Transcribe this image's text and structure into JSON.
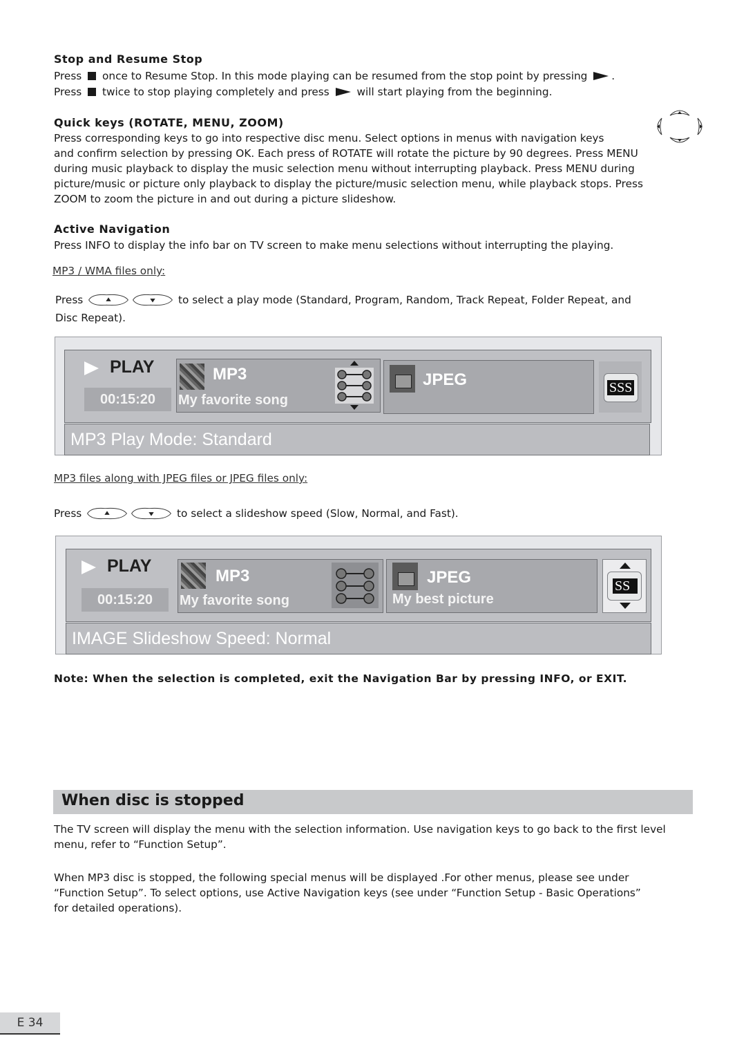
{
  "stop_section": {
    "heading": "Stop  and  Resume  Stop",
    "line1_pre": "Press",
    "line1_post": "once to Resume Stop. In this mode playing can be resumed from the stop point by pressing",
    "line1_end": ".",
    "line2_pre": "Press",
    "line2_mid": "twice to stop playing completely and press",
    "line2_post": "will start playing from the beginning.",
    "stop_icon": "stop-square-icon",
    "play_icon": "play-triangle-icon"
  },
  "quick_keys": {
    "heading": "Quick keys (ROTATE, MENU, ZOOM)",
    "line1": "Press corresponding keys to go into respective disc menu.  Select options in menus with navigation keys",
    "line2": "and confirm selection by pressing OK.  Each press of ROTATE will rotate the picture by 90 degrees.  Press MENU",
    "line3": "during music playback to display the music selection menu without interrupting playback.  Press MENU during",
    "line4": "picture/music or picture only playback to display the picture/music selection menu, while playback stops.  Press",
    "line5": "ZOOM  to zoom the picture in and out during a picture slideshow.",
    "nav_icon": "navigation-keys-icon"
  },
  "active_nav": {
    "heading": "Active  Navigation",
    "text": "Press INFO  to display the info bar on TV screen to make menu selections without interrupting the playing."
  },
  "mp3_wma": {
    "label": "MP3 / WMA files only:",
    "press": "Press",
    "text_a": "to select a play mode (Standard, Program, Random, Track Repeat, Folder Repeat, and",
    "text_b": "Disc Repeat)."
  },
  "osd1": {
    "play_label": "PLAY",
    "time": "00:15:20",
    "mp3_title": "MP3",
    "mp3_song": "My favorite song",
    "jpeg_title": "JPEG",
    "jpeg_sub": "",
    "speed_label": "SSS",
    "mode_text": "MP3 Play Mode: Standard"
  },
  "jpeg_section": {
    "label": "MP3 files along with JPEG files or JPEG files only:",
    "press": "Press",
    "text": "to select a slideshow speed (Slow, Normal, and Fast)."
  },
  "osd2": {
    "play_label": "PLAY",
    "time": "00:15:20",
    "mp3_title": "MP3",
    "mp3_song": "My favorite song",
    "jpeg_title": "JPEG",
    "jpeg_sub": "My best picture",
    "speed_label": "SS",
    "mode_text": "IMAGE Slideshow Speed: Normal"
  },
  "note": "Note:  When the selection is completed, exit the Navigation Bar by pressing INFO, or EXIT.",
  "stopped_section": {
    "title": "When  disc  is  stopped",
    "p1_l1": "The TV screen will display the menu with the selection information. Use navigation keys to go back to the first level",
    "p1_l2": "menu, refer to “Function Setup”.",
    "p2_l1": "When MP3 disc is stopped, the following special menus will be displayed .For other menus, please see under",
    "p2_l2": "“Function Setup”. To select options, use Active Navigation keys (see under “Function Setup - Basic Operations”",
    "p2_l3": "for detailed operations)."
  },
  "page_number": "E 34"
}
